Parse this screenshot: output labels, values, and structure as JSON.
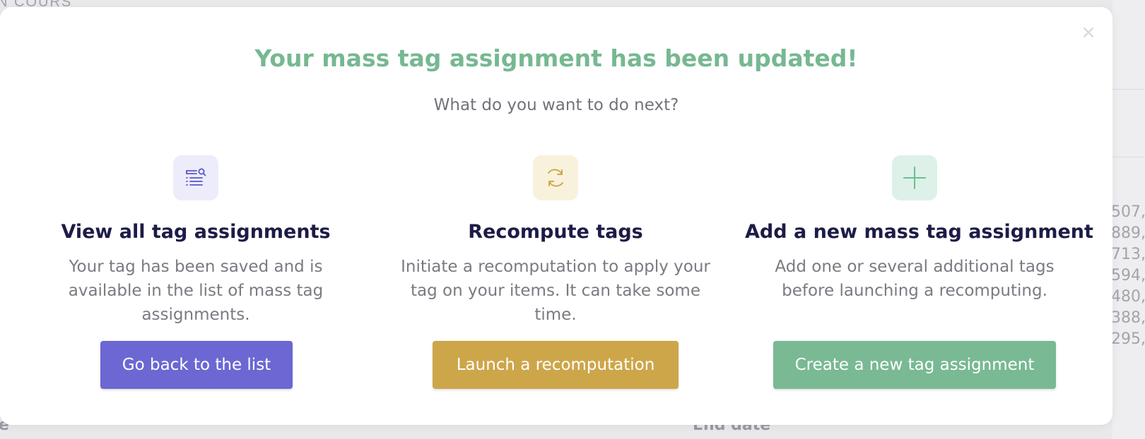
{
  "background": {
    "header_fragment": "N COURS",
    "numbers": [
      "507,",
      "889,",
      "713,",
      "594,",
      "480,",
      "388,",
      "295,"
    ],
    "bottom_left_fragment": "e",
    "end_date_label": "End date"
  },
  "modal": {
    "close_icon": "×",
    "title": "Your mass tag assignment has been updated!",
    "subtitle": "What do you want to do next?",
    "options": [
      {
        "icon": "list-search-icon",
        "icon_bg": "#ececfa",
        "icon_color": "#5a57c9",
        "title": "View all tag assignments",
        "description": "Your tag has been saved and is available in the list of mass tag assignments.",
        "button_label": "Go back to the list",
        "button_color": "#6c67d2"
      },
      {
        "icon": "refresh-icon",
        "icon_bg": "#f8f2dd",
        "icon_color": "#cfa94a",
        "title": "Recompute tags",
        "description": "Initiate a recomputation to apply your tag on your items. It can take some time.",
        "button_label": "Launch a recomputation",
        "button_color": "#cda64a"
      },
      {
        "icon": "plus-icon",
        "icon_bg": "#ddf1e8",
        "icon_color": "#6dbd93",
        "title": "Add a new mass tag assignment",
        "description": "Add one or several additional tags before launching a recomputing.",
        "button_label": "Create a new tag assignment",
        "button_color": "#79b993"
      }
    ]
  }
}
